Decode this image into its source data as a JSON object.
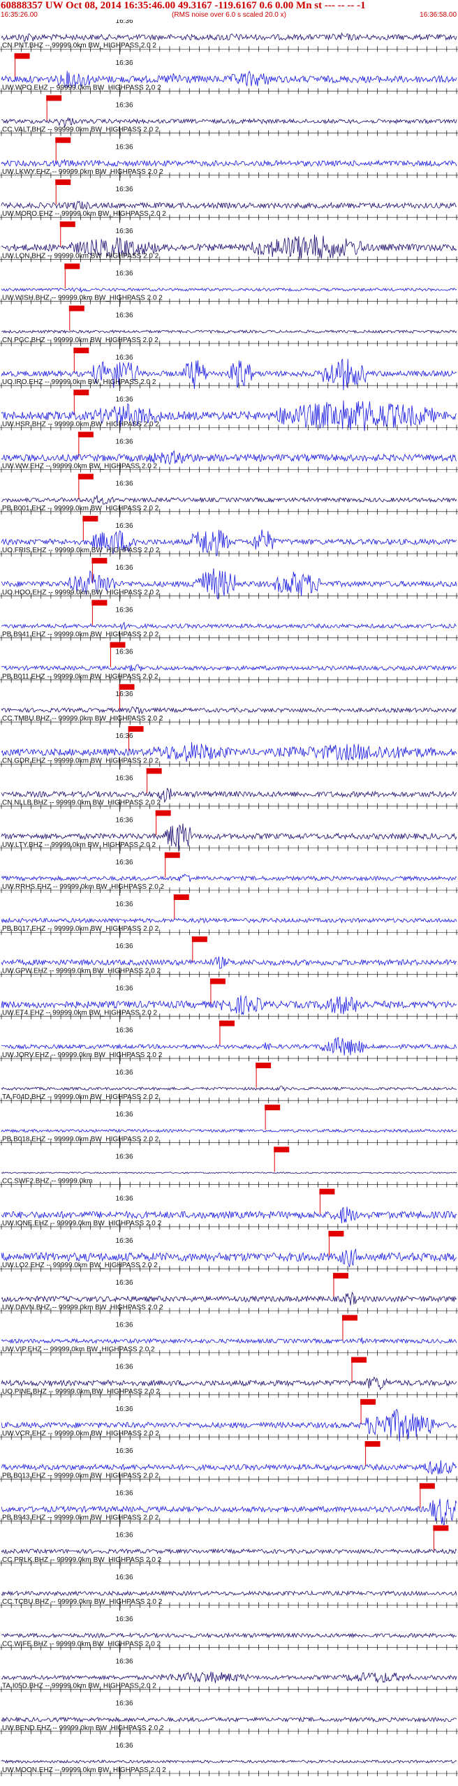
{
  "header": {
    "title": "60888357 UW Oct 08, 2014 16:35:46.00   49.3167 -119.6167  0.6 0.00 Mn st --- -- --   -1",
    "start_time": "16:35:26.00",
    "end_time": "16:36:58.00",
    "note": "(RMS noise over 6.0 s scaled 20.0 x)"
  },
  "chart_data": {
    "type": "line",
    "minute_label": "16:36",
    "colors": {
      "trace_a": "#1a0a6e",
      "trace_b": "#1515e0",
      "pick": "#e00000",
      "tick": "#000000"
    },
    "traces": [
      {
        "label": "CN.PNT.BHZ -- 99999.0km BW_HIGHPASS 2.0 2",
        "color": "trace_a",
        "amp": 4,
        "pick": 0.03,
        "bursts": [
          [
            0.03,
            0.08,
            2
          ],
          [
            0.45,
            0.55,
            1.5
          ],
          [
            0.7,
            0.8,
            1.5
          ]
        ]
      },
      {
        "label": "UW.WPO.EHZ -- 99999.0km BW_HIGHPASS 2.0 2",
        "color": "trace_b",
        "amp": 5,
        "pick": 0.1,
        "bursts": [
          [
            0.12,
            0.2,
            3
          ],
          [
            0.35,
            0.42,
            2
          ],
          [
            0.5,
            0.6,
            2.5
          ]
        ]
      },
      {
        "label": "CC.VALT.BHZ -- 99999.0km BW_HIGHPASS 2.0 2",
        "color": "trace_a",
        "amp": 3,
        "pick": 0.12,
        "bursts": [
          [
            0.12,
            0.16,
            3
          ],
          [
            0.5,
            0.6,
            1.5
          ]
        ]
      },
      {
        "label": "UW.LKWY.EHZ -- 99999.0km BW_HIGHPASS 2.0 2",
        "color": "trace_b",
        "amp": 4,
        "pick": 0.12,
        "bursts": [
          [
            0.1,
            0.18,
            1.5
          ]
        ]
      },
      {
        "label": "UW.MORO.EHZ -- 99999.0km BW_HIGHPASS 2.0 2",
        "color": "trace_a",
        "amp": 4,
        "pick": 0.13,
        "bursts": [
          [
            0.14,
            0.2,
            2
          ]
        ]
      },
      {
        "label": "UW.LON.BHZ -- 99999.0km BW_HIGHPASS 2.0 2",
        "color": "trace_a",
        "amp": 5,
        "pick": 0.14,
        "bursts": [
          [
            0.15,
            0.35,
            3
          ],
          [
            0.55,
            0.8,
            4
          ]
        ]
      },
      {
        "label": "UW.WISH.BHZ -- 99999.0km BW_HIGHPASS 2.0 2",
        "color": "trace_b",
        "amp": 2,
        "pick": 0.15,
        "bursts": [
          [
            0.15,
            0.2,
            2
          ]
        ]
      },
      {
        "label": "CN.PGC.BHZ -- 99999.0km BW_HIGHPASS 2.0 2",
        "color": "trace_a",
        "amp": 2,
        "pick": 0.16,
        "bursts": []
      },
      {
        "label": "UO.IRO.EHZ -- 99999.0km BW_HIGHPASS 2.0 2",
        "color": "trace_b",
        "amp": 4,
        "pick": 0.16,
        "bursts": [
          [
            0.2,
            0.3,
            6
          ],
          [
            0.4,
            0.45,
            6
          ],
          [
            0.5,
            0.55,
            6
          ],
          [
            0.7,
            0.8,
            6
          ]
        ]
      },
      {
        "label": "UW.HSR.BHZ -- 99999.0km BW_HIGHPASS 2.0 2",
        "color": "trace_b",
        "amp": 6,
        "pick": 0.17,
        "bursts": [
          [
            0.2,
            0.35,
            3
          ],
          [
            0.6,
            0.95,
            4
          ]
        ]
      },
      {
        "label": "UW.WW.EHZ -- 99999.0km BW_HIGHPASS 2.0 2",
        "color": "trace_b",
        "amp": 5,
        "pick": 0.17,
        "bursts": [
          [
            0.3,
            0.45,
            2
          ]
        ]
      },
      {
        "label": "PB.B001.EHZ -- 99999.0km BW_HIGHPASS 2.0 2",
        "color": "trace_a",
        "amp": 3,
        "pick": 0.18,
        "bursts": [
          [
            0.18,
            0.25,
            2.5
          ]
        ]
      },
      {
        "label": "UO.FRIS.EHZ -- 99999.0km BW_HIGHPASS 2.0 2",
        "color": "trace_b",
        "amp": 4,
        "pick": 0.2,
        "bursts": [
          [
            0.2,
            0.3,
            5
          ],
          [
            0.42,
            0.5,
            6
          ],
          [
            0.55,
            0.6,
            5
          ]
        ]
      },
      {
        "label": "UO.HOO.EHZ -- 99999.0km BW_HIGHPASS 2.0 2",
        "color": "trace_b",
        "amp": 4,
        "pick": 0.2,
        "bursts": [
          [
            0.15,
            0.25,
            5
          ],
          [
            0.42,
            0.52,
            6
          ],
          [
            0.6,
            0.7,
            5
          ]
        ]
      },
      {
        "label": "PB.B941.EHZ -- 99999.0km BW_HIGHPASS 2.0 2",
        "color": "trace_b",
        "amp": 3,
        "pick": 0.24,
        "bursts": [
          [
            0.25,
            0.3,
            2
          ]
        ]
      },
      {
        "label": "PB.B011.EHZ -- 99999.0km BW_HIGHPASS 2.0 2",
        "color": "trace_b",
        "amp": 3,
        "pick": 0.26,
        "bursts": [
          [
            0.27,
            0.32,
            2
          ]
        ]
      },
      {
        "label": "CC.TMBU.BHZ -- 99999.0km BW_HIGHPASS 2.0 2",
        "color": "trace_a",
        "amp": 3,
        "pick": 0.28,
        "bursts": [
          [
            0.28,
            0.32,
            2.5
          ]
        ]
      },
      {
        "label": "CN.GDR.EHZ -- 99999.0km BW_HIGHPASS 2.0 2",
        "color": "trace_b",
        "amp": 5,
        "pick": 0.32,
        "bursts": [
          [
            0.33,
            0.5,
            3
          ],
          [
            0.6,
            0.95,
            2.5
          ]
        ]
      },
      {
        "label": "CN.NLLB.BHZ -- 99999.0km BW_HIGHPASS 2.0 2",
        "color": "trace_a",
        "amp": 4,
        "pick": 0.34,
        "bursts": [
          [
            0.34,
            0.38,
            3
          ]
        ]
      },
      {
        "label": "UW.LTY.BHZ -- 99999.0km BW_HIGHPASS 2.0 2",
        "color": "trace_a",
        "amp": 4,
        "pick": 0.36,
        "bursts": [
          [
            0.36,
            0.42,
            6
          ]
        ]
      },
      {
        "label": "UW.RRHS.EHZ -- 99999.0km BW_HIGHPASS 2.0 2",
        "color": "trace_b",
        "amp": 3,
        "pick": 0.38,
        "bursts": [
          [
            0.39,
            0.42,
            3
          ]
        ]
      },
      {
        "label": "PB.B017.EHZ -- 99999.0km BW_HIGHPASS 2.0 2",
        "color": "trace_b",
        "amp": 3,
        "pick": 0.42,
        "bursts": [
          [
            0.43,
            0.45,
            2
          ]
        ]
      },
      {
        "label": "UW.GPW.EHZ -- 99999.0km BW_HIGHPASS 2.0 2",
        "color": "trace_b",
        "amp": 4,
        "pick": 0.46,
        "bursts": [
          [
            0.46,
            0.5,
            2.5
          ]
        ]
      },
      {
        "label": "UW.ET4.EHZ -- 99999.0km BW_HIGHPASS 2.0 2",
        "color": "trace_b",
        "amp": 5,
        "pick": 0.48,
        "bursts": [
          [
            0.48,
            0.58,
            3
          ],
          [
            0.7,
            0.8,
            3
          ]
        ]
      },
      {
        "label": "UW.JORV.EHZ -- 99999.0km BW_HIGHPASS 2.0 2",
        "color": "trace_b",
        "amp": 3,
        "pick": 0.56,
        "bursts": [
          [
            0.56,
            0.6,
            2
          ],
          [
            0.7,
            0.8,
            5
          ]
        ]
      },
      {
        "label": "TA.F04D.BHZ -- 99999.0km BW_HIGHPASS 2.0 2",
        "color": "trace_a",
        "amp": 2,
        "pick": 0.58,
        "bursts": [
          [
            0.6,
            0.63,
            2
          ]
        ]
      },
      {
        "label": "PB.B018.EHZ -- 99999.0km BW_HIGHPASS 2.0 2",
        "color": "trace_b",
        "amp": 2,
        "pick": 0.6,
        "bursts": []
      },
      {
        "label": "CC.SWF2.BHZ -- 99999.0km",
        "color": "trace_a",
        "amp": 1,
        "pick": 0.7,
        "bursts": []
      },
      {
        "label": "UW.IONE.EHZ -- 99999.0km BW_HIGHPASS 2.0 2",
        "color": "trace_b",
        "amp": 5,
        "pick": 0.72,
        "bursts": [
          [
            0.73,
            0.78,
            3
          ]
        ]
      },
      {
        "label": "UW.LO2.EHZ -- 99999.0km BW_HIGHPASS 2.0 2",
        "color": "trace_b",
        "amp": 6,
        "pick": 0.73,
        "bursts": [
          [
            0.74,
            0.79,
            2.5
          ]
        ]
      },
      {
        "label": "UW.DAVN.BHZ -- 99999.0km BW_HIGHPASS 2.0 2",
        "color": "trace_a",
        "amp": 4,
        "pick": 0.75,
        "bursts": [
          [
            0.75,
            0.78,
            3
          ]
        ]
      },
      {
        "label": "UW.VIP.EHZ -- 99999.0km BW_HIGHPASS 2.0 2",
        "color": "trace_b",
        "amp": 3,
        "pick": 0.77,
        "bursts": [
          [
            0.78,
            0.8,
            2
          ]
        ]
      },
      {
        "label": "UO.PINE.BHZ -- 99999.0km BW_HIGHPASS 2.0 2",
        "color": "trace_a",
        "amp": 4,
        "pick": 0.79,
        "bursts": [
          [
            0.8,
            0.85,
            3
          ]
        ]
      },
      {
        "label": "UW.VCR.EHZ -- 99999.0km BW_HIGHPASS 2.0 2",
        "color": "trace_b",
        "amp": 4,
        "pick": 0.8,
        "bursts": [
          [
            0.8,
            0.95,
            6
          ]
        ]
      },
      {
        "label": "PB.B013.EHZ -- 99999.0km BW_HIGHPASS 2.0 2",
        "color": "trace_b",
        "amp": 4,
        "pick": 0.92,
        "bursts": [
          [
            0.92,
            1.0,
            3
          ]
        ]
      },
      {
        "label": "PB.B943.EHZ -- 99999.0km BW_HIGHPASS 2.0 2",
        "color": "trace_b",
        "amp": 4,
        "pick": 0.95,
        "bursts": [
          [
            0.94,
            1.0,
            6
          ]
        ]
      },
      {
        "label": "CC.PRLK.BHZ -- 99999.0km BW_HIGHPASS 2.0 2",
        "color": "trace_a",
        "amp": 3,
        "pick": null,
        "bursts": []
      },
      {
        "label": "CC.TCBU.BHZ -- 99999.0km BW_HIGHPASS 2.0 2",
        "color": "trace_a",
        "amp": 3,
        "pick": null,
        "bursts": []
      },
      {
        "label": "CC.WIFE.BHZ -- 99999.0km BW_HIGHPASS 2.0 2",
        "color": "trace_a",
        "amp": 3,
        "pick": null,
        "bursts": []
      },
      {
        "label": "TA.I05D.BHZ -- 99999.0km BW_HIGHPASS 2.0 2",
        "color": "trace_a",
        "amp": 3,
        "pick": null,
        "bursts": [
          [
            0.35,
            0.55,
            3
          ],
          [
            0.75,
            0.9,
            3
          ]
        ]
      },
      {
        "label": "UW.BEND.EHZ -- 99999.0km BW_HIGHPASS 2.0 2",
        "color": "trace_a",
        "amp": 3,
        "pick": null,
        "bursts": []
      },
      {
        "label": "UW.MOON.EHZ -- 99999.0km BW_HIGHPASS 2.0 2",
        "color": "trace_a",
        "amp": 2,
        "pick": null,
        "bursts": []
      }
    ]
  }
}
